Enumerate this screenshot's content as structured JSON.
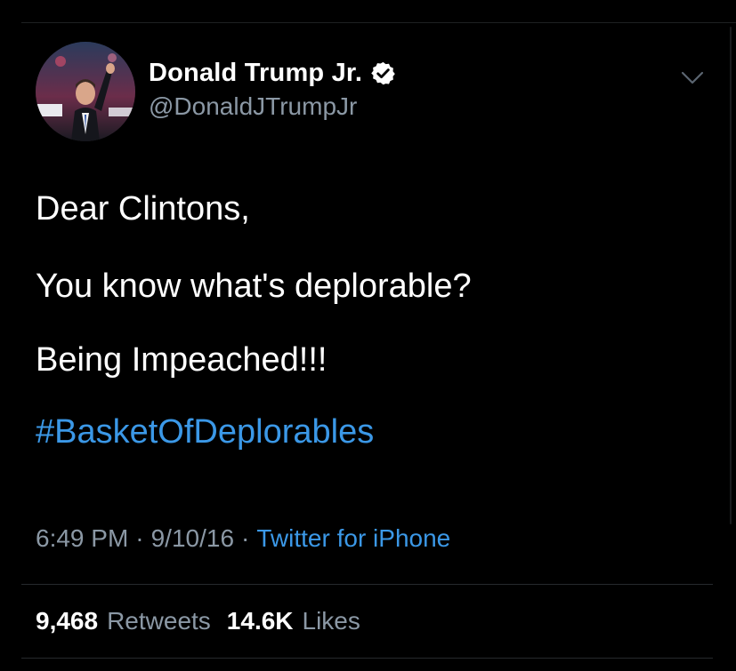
{
  "user": {
    "display_name": "Donald Trump Jr.",
    "handle": "@DonaldJTrumpJr",
    "verified": true,
    "avatar_icon": "profile-photo"
  },
  "tweet": {
    "lines": [
      "Dear Clintons,",
      "You know what's deplorable?",
      "Being Impeached!!!",
      "#BasketOfDeplorables"
    ]
  },
  "meta": {
    "time": "6:49 PM",
    "separator": "·",
    "date": "9/10/16",
    "source": "Twitter for iPhone"
  },
  "stats": {
    "retweets_count": "9,468",
    "retweets_label": "Retweets",
    "likes_count": "14.6K",
    "likes_label": "Likes"
  },
  "colors": {
    "background": "#000000",
    "link": "#3b98e7",
    "secondary_text": "#8b98a5",
    "divider": "#26292d"
  }
}
